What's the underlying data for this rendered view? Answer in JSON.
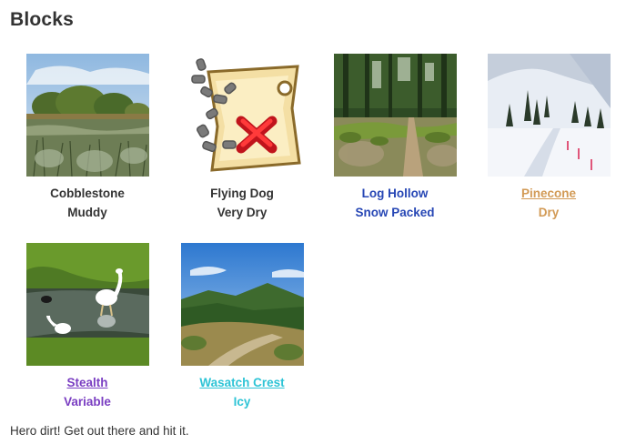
{
  "page": {
    "title": "Blocks",
    "footer": "Hero dirt! Get out there and hit it."
  },
  "blocks": [
    {
      "name": "Cobblestone",
      "condition": "Muddy",
      "color": "#333333",
      "linked": false,
      "image": "marsh-meadow-photo"
    },
    {
      "name": "Flying Dog",
      "condition": "Very Dry",
      "color": "#333333",
      "linked": false,
      "image": "treasure-map-icon"
    },
    {
      "name": "Log Hollow",
      "condition": "Snow Packed",
      "color": "#2747b5",
      "linked": false,
      "image": "forest-trail-photo"
    },
    {
      "name": "Pinecone",
      "condition": "Dry",
      "color": "#d29a55",
      "linked": true,
      "image": "snowy-trail-photo"
    },
    {
      "name": "Stealth",
      "condition": "Variable",
      "color": "#7a3ec2",
      "linked": true,
      "image": "egrets-pond-photo"
    },
    {
      "name": "Wasatch Crest",
      "condition": "Icy",
      "color": "#2ec4d6",
      "linked": true,
      "image": "mountain-ridge-photo"
    }
  ]
}
